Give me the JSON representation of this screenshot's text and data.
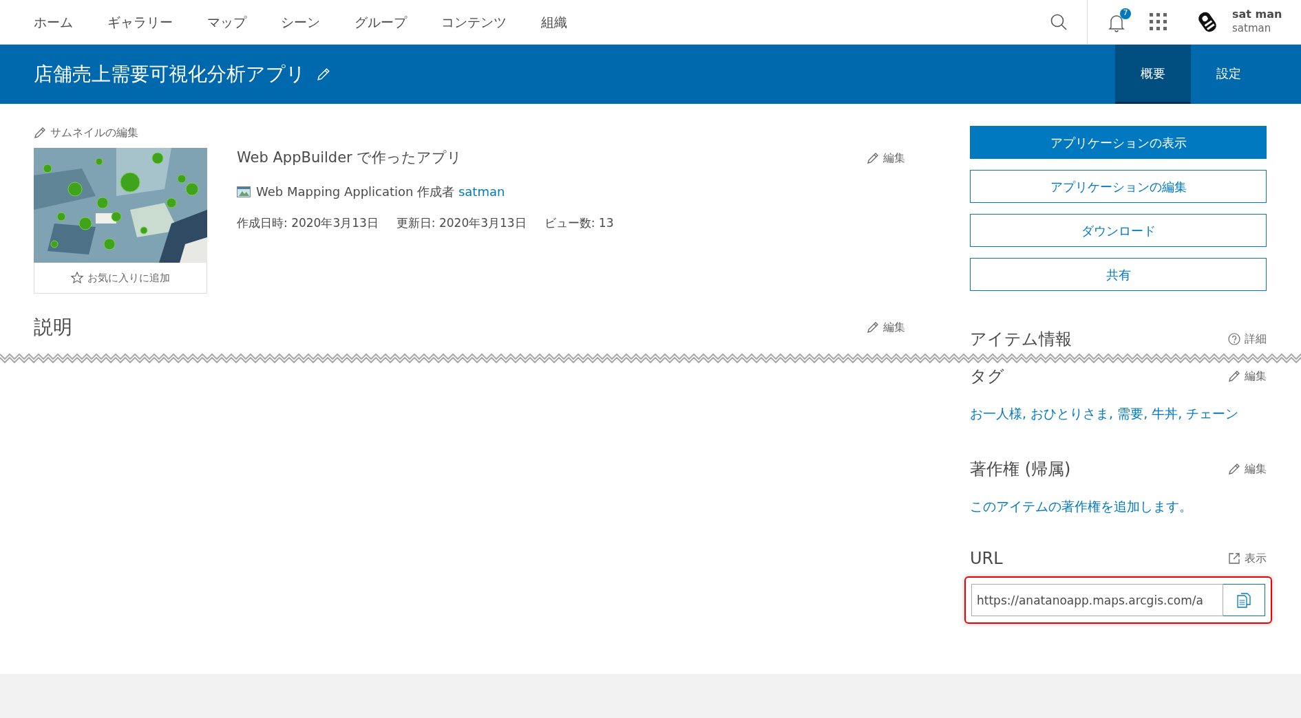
{
  "nav": {
    "items": [
      {
        "label": "ホーム",
        "selected": false
      },
      {
        "label": "ギャラリー",
        "selected": false
      },
      {
        "label": "マップ",
        "selected": false
      },
      {
        "label": "シーン",
        "selected": false
      },
      {
        "label": "グループ",
        "selected": false
      },
      {
        "label": "コンテンツ",
        "selected": false
      },
      {
        "label": "組織",
        "selected": false
      }
    ],
    "notifications": "7",
    "user": {
      "name": "sat man",
      "username": "satman"
    }
  },
  "header": {
    "title": "店舗売上需要可視化分析アプリ",
    "tabs": [
      {
        "label": "概要",
        "selected": true
      },
      {
        "label": "設定",
        "selected": false
      }
    ]
  },
  "thumbnail": {
    "edit_label": "サムネイルの編集",
    "favorite_label": "お気に入りに追加",
    "favorited": false
  },
  "item": {
    "summary": "Web AppBuilder で作ったアプリ",
    "summary_edit": "編集",
    "type": "Web Mapping Application",
    "owner_label": "作成者",
    "owner": "satman",
    "created": "作成日時: 2020年3月13日",
    "modified": "更新日: 2020年3月13日",
    "views": "ビュー数: 13"
  },
  "description": {
    "heading": "説明",
    "edit": "編集"
  },
  "actions": [
    {
      "label": "アプリケーションの表示",
      "kind": "primary"
    },
    {
      "label": "アプリケーションの編集",
      "kind": "outline"
    },
    {
      "label": "ダウンロード",
      "kind": "outline"
    },
    {
      "label": "共有",
      "kind": "outline"
    }
  ],
  "item_info": {
    "heading": "アイテム情報",
    "details": "詳細"
  },
  "tags": {
    "heading": "タグ",
    "edit": "編集",
    "text": "お一人様, おひとりさま, 需要, 牛丼, チェーン"
  },
  "credits": {
    "heading": "著作権 (帰属)",
    "edit": "編集",
    "link": "このアイテムの著作権を追加します。"
  },
  "url": {
    "heading": "URL",
    "view": "表示",
    "value": "https://anatanoapp.maps.arcgis.com/a",
    "highlighted": true
  }
}
